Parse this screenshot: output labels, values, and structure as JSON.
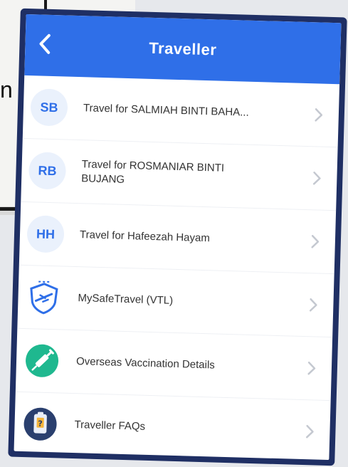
{
  "background": {
    "partial_text": "n"
  },
  "header": {
    "title": "Traveller",
    "accent": "#2f6fe8"
  },
  "items": [
    {
      "avatar": "SB",
      "label": "Travel for SALMIAH BINTI BAHA..."
    },
    {
      "avatar": "RB",
      "label": "Travel for ROSMANIAR BINTI BUJANG"
    },
    {
      "avatar": "HH",
      "label": "Travel for Hafeezah Hayam"
    },
    {
      "icon": "shield-plane-icon",
      "label": "MySafeTravel (VTL)"
    },
    {
      "icon": "vaccine-syringe-icon",
      "label": "Overseas Vaccination Details"
    },
    {
      "icon": "question-clipboard-icon",
      "label": "Traveller FAQs"
    }
  ]
}
